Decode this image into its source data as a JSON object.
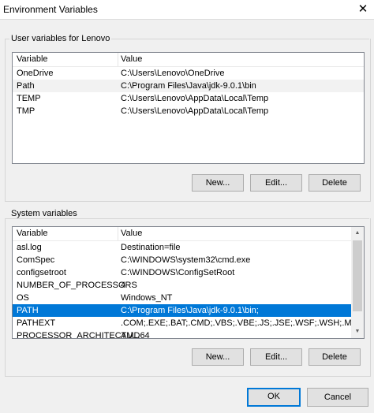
{
  "window": {
    "title": "Environment Variables",
    "close_glyph": "✕"
  },
  "user_vars": {
    "label": "User variables for Lenovo",
    "columns": [
      "Variable",
      "Value"
    ],
    "rows": [
      {
        "name": "OneDrive",
        "value": "C:\\Users\\Lenovo\\OneDrive"
      },
      {
        "name": "Path",
        "value": "C:\\Program Files\\Java\\jdk-9.0.1\\bin"
      },
      {
        "name": "TEMP",
        "value": "C:\\Users\\Lenovo\\AppData\\Local\\Temp"
      },
      {
        "name": "TMP",
        "value": "C:\\Users\\Lenovo\\AppData\\Local\\Temp"
      }
    ],
    "buttons": {
      "new": "New...",
      "edit": "Edit...",
      "delete": "Delete"
    }
  },
  "system_vars": {
    "label": "System variables",
    "columns": [
      "Variable",
      "Value"
    ],
    "rows": [
      {
        "name": "asl.log",
        "value": "Destination=file"
      },
      {
        "name": "ComSpec",
        "value": "C:\\WINDOWS\\system32\\cmd.exe"
      },
      {
        "name": "configsetroot",
        "value": "C:\\WINDOWS\\ConfigSetRoot"
      },
      {
        "name": "NUMBER_OF_PROCESSORS",
        "value": "4"
      },
      {
        "name": "OS",
        "value": "Windows_NT"
      },
      {
        "name": "PATH",
        "value": "C:\\Program Files\\Java\\jdk-9.0.1\\bin;"
      },
      {
        "name": "PATHEXT",
        "value": ".COM;.EXE;.BAT;.CMD;.VBS;.VBE;.JS;.JSE;.WSF;.WSH;.MSC"
      },
      {
        "name": "PROCESSOR_ARCHITECTU...",
        "value": "AMD64"
      }
    ],
    "selected_row": "PATH",
    "buttons": {
      "new": "New...",
      "edit": "Edit...",
      "delete": "Delete"
    }
  },
  "dialog_buttons": {
    "ok": "OK",
    "cancel": "Cancel"
  },
  "colors": {
    "selection": "#0078d7",
    "alt_row": "#f2f2f2"
  }
}
